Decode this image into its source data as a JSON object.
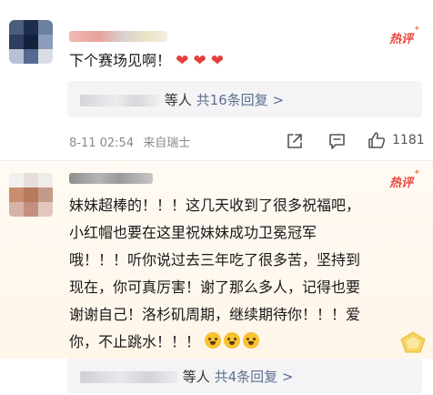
{
  "comments": [
    {
      "hot_label": "热评",
      "text": "下个赛场见啊！",
      "hearts": [
        "❤",
        "❤",
        "❤"
      ],
      "reply_suffix": "等人",
      "reply_count": "共16条回复",
      "reply_chevron": ">",
      "date": "8-11 02:54",
      "location": "来自瑞士",
      "like_count": "1181"
    },
    {
      "hot_label": "热评",
      "lines": [
        "妹妹超棒的！！！这几天收到了很多祝福吧，",
        "小红帽也要在这里祝妹妹成功卫冕冠军",
        "哦！！！听你说过去三年吃了很多苦，坚持到",
        "现在，你可真厉害！谢了那么多人，记得也要",
        "谢谢自己！洛杉矶周期，继续期待你！！！爱",
        "你，不止跳水！！！"
      ],
      "reply_suffix": "等人",
      "reply_count": "共4条回复",
      "reply_chevron": ">"
    }
  ],
  "colors": {
    "hot": "#e8453c",
    "reply_link": "#5d6f90",
    "heart": "#e0413b",
    "highlight_bg": "#fff8ef"
  },
  "icons": [
    "share-icon",
    "comment-icon",
    "like-icon",
    "golden-badge-icon"
  ]
}
